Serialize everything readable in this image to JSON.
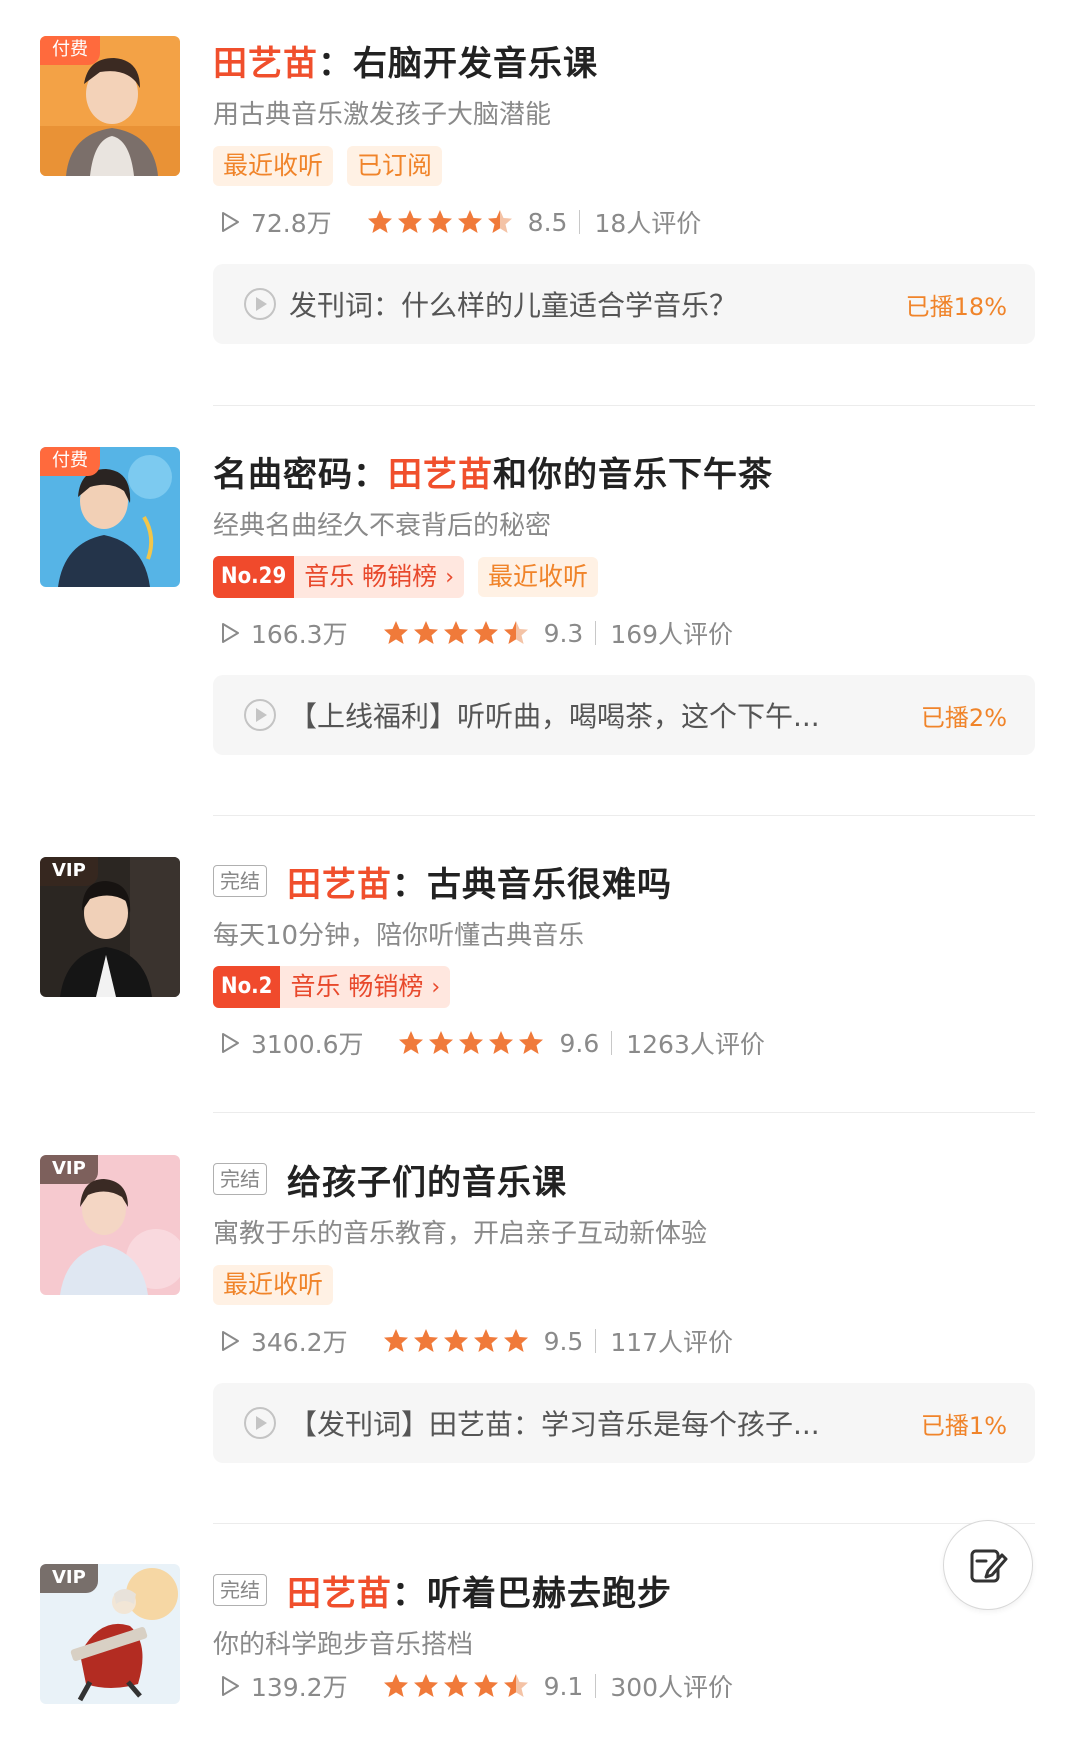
{
  "courses": [
    {
      "badge": "付费",
      "title_pre": "田艺苗",
      "title_mid": "：右脑开发音乐课",
      "subtitle": "用古典音乐激发孩子大脑潜能",
      "tags": [
        "最近收听",
        "已订阅"
      ],
      "plays": "72.8万",
      "rating_stars": 4.5,
      "score": "8.5",
      "reviews": "18人评价",
      "episode": "发刊词：什么样的儿童适合学音乐？",
      "progress": "已播18%"
    },
    {
      "badge": "付费",
      "title_pre": "名曲密码：",
      "title_hl": "田艺苗",
      "title_post": "和你的音乐下午茶",
      "subtitle": "经典名曲经久不衰背后的秘密",
      "rank_no": "No.29",
      "rank_label": "音乐 畅销榜",
      "tags": [
        "最近收听"
      ],
      "plays": "166.3万",
      "rating_stars": 4.5,
      "score": "9.3",
      "reviews": "169人评价",
      "episode": "【上线福利】听听曲，喝喝茶，这个下午...",
      "progress": "已播2%"
    },
    {
      "badge": "VIP",
      "finished": "完结",
      "title_hl": "田艺苗",
      "title_post": "：古典音乐很难吗",
      "subtitle": "每天10分钟，陪你听懂古典音乐",
      "rank_no": "No.2",
      "rank_label": "音乐 畅销榜",
      "plays": "3100.6万",
      "rating_stars": 5,
      "score": "9.6",
      "reviews": "1263人评价"
    },
    {
      "badge": "VIP",
      "finished": "完结",
      "title_post": "给孩子们的音乐课",
      "subtitle": "寓教于乐的音乐教育，开启亲子互动新体验",
      "tags": [
        "最近收听"
      ],
      "plays": "346.2万",
      "rating_stars": 5,
      "score": "9.5",
      "reviews": "117人评价",
      "episode": "【发刊词】田艺苗：学习音乐是每个孩子...",
      "progress": "已播1%"
    },
    {
      "badge": "VIP",
      "finished": "完结",
      "title_hl": "田艺苗",
      "title_post": "：听着巴赫去跑步",
      "subtitle": "你的科学跑步音乐搭档",
      "plays": "139.2万",
      "rating_stars": 4.5,
      "score": "9.1",
      "reviews": "300人评价"
    }
  ],
  "icons": {
    "play": "play-triangle-icon",
    "episode": "play-circle-icon",
    "star": "star-icon",
    "fab": "edit-note-icon"
  },
  "colors": {
    "accent": "#f04f2c",
    "tag_orange": "#f0842a",
    "star": "#f07a3a",
    "text_gray": "#8a8a8a"
  }
}
